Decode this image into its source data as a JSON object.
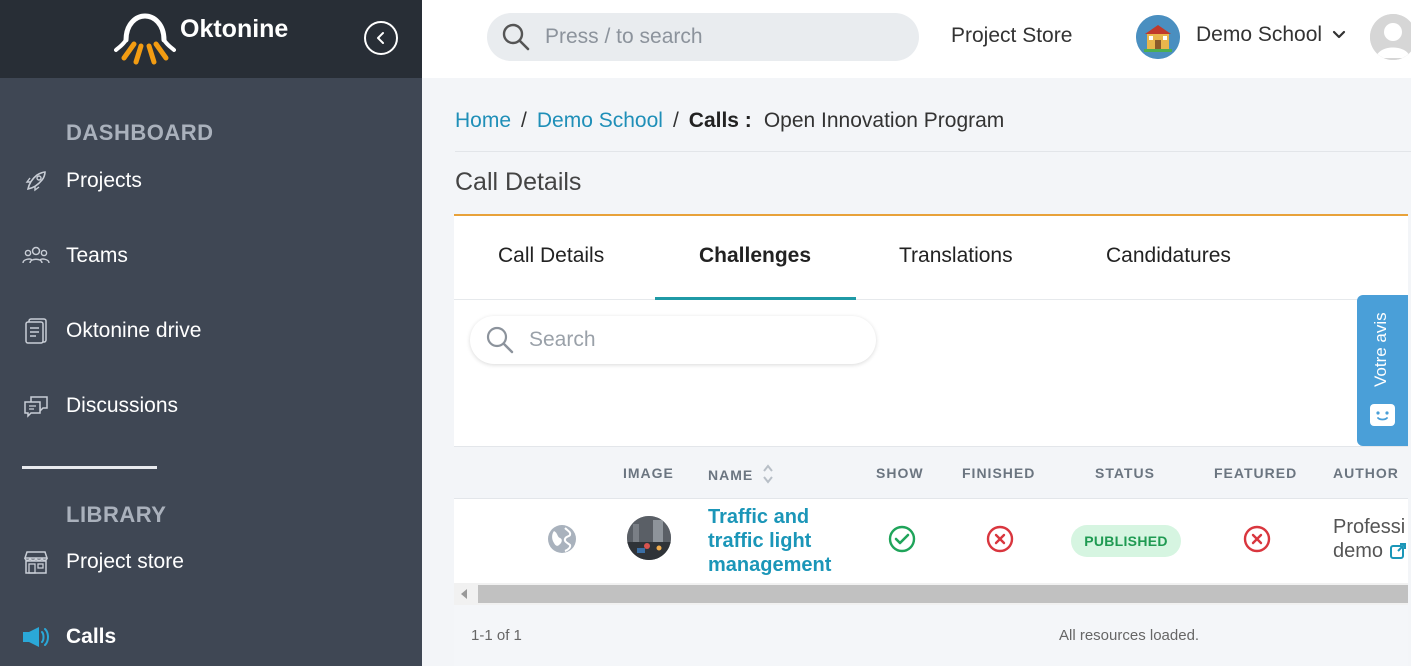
{
  "app": {
    "logo_text": "Oktonine"
  },
  "sidebar": {
    "sections": [
      {
        "title": "DASHBOARD"
      },
      {
        "title": "LIBRARY"
      }
    ],
    "items": [
      {
        "label": "Projects",
        "icon": "rocket-icon"
      },
      {
        "label": "Teams",
        "icon": "users-icon"
      },
      {
        "label": "Oktonine drive",
        "icon": "document-icon"
      },
      {
        "label": "Discussions",
        "icon": "chat-icon"
      },
      {
        "label": "Project store",
        "icon": "store-icon"
      },
      {
        "label": "Calls",
        "icon": "megaphone-icon",
        "active": true
      }
    ]
  },
  "topbar": {
    "search_placeholder": "Press / to search",
    "project_store": "Project Store",
    "school_name": "Demo School"
  },
  "breadcrumb": {
    "home": "Home",
    "school": "Demo School",
    "calls": "Calls :",
    "current": "Open Innovation Program"
  },
  "page": {
    "title": "Call Details"
  },
  "tabs": [
    {
      "label": "Call Details"
    },
    {
      "label": "Challenges",
      "active": true
    },
    {
      "label": "Translations"
    },
    {
      "label": "Candidatures"
    }
  ],
  "search": {
    "placeholder": "Search"
  },
  "table": {
    "columns": [
      "IMAGE",
      "NAME",
      "SHOW",
      "FINISHED",
      "STATUS",
      "FEATURED",
      "AUTHOR"
    ],
    "rows": [
      {
        "name": "Traffic and traffic light management",
        "show": true,
        "finished": false,
        "status": "PUBLISHED",
        "featured": false,
        "author": "Professi",
        "author_line2": "demo"
      }
    ]
  },
  "footer": {
    "count": "1-1 of 1",
    "loaded": "All resources loaded."
  },
  "feedback": {
    "label": "Votre avis"
  },
  "colors": {
    "sidebar_bg": "#3f4754",
    "sidebar_top": "#282e36",
    "accent": "#1f9aa6",
    "link": "#1b96b8",
    "orange": "#e8a23a",
    "success": "#1f9a52",
    "danger": "#d9363e"
  }
}
